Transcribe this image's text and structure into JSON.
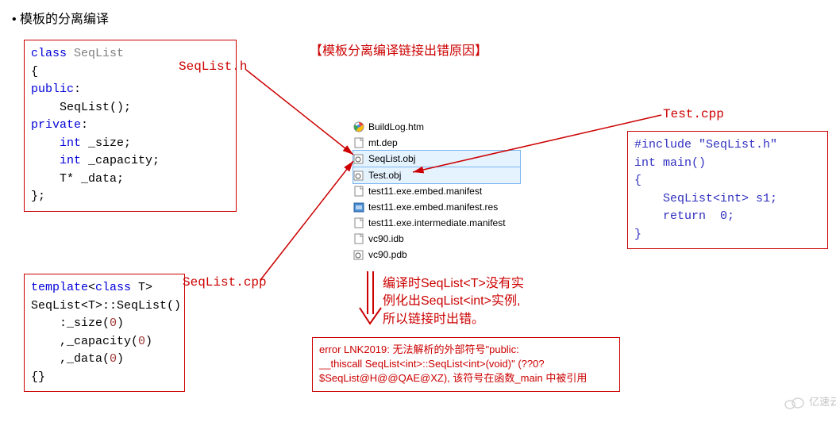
{
  "heading": "模板的分离编译",
  "title_center": "【模板分离编译链接出错原因】",
  "labels": {
    "seqlist_h": "SeqList.h",
    "seqlist_cpp": "SeqList.cpp",
    "test_cpp": "Test.cpp"
  },
  "code_blocks": {
    "seqlist_h": "class SeqList\n{\npublic:\n    SeqList();\nprivate:\n    int _size;\n    int _capacity;\n    T* _data;\n};",
    "seqlist_cpp": "template<class T>\nSeqList<T>::SeqList()\n    :_size(0)\n    ,_capacity(0)\n    ,_data(0)\n{}",
    "test_cpp": "#include \"SeqList.h\"\nint main()\n{\n    SeqList<int> s1;\n    return  0;\n}"
  },
  "file_list": [
    {
      "name": "BuildLog.htm",
      "icon": "chrome"
    },
    {
      "name": "mt.dep",
      "icon": "file"
    },
    {
      "name": "SeqList.obj",
      "icon": "obj",
      "selected": true
    },
    {
      "name": "Test.obj",
      "icon": "obj",
      "selected": true
    },
    {
      "name": "test11.exe.embed.manifest",
      "icon": "file"
    },
    {
      "name": "test11.exe.embed.manifest.res",
      "icon": "res"
    },
    {
      "name": "test11.exe.intermediate.manifest",
      "icon": "file"
    },
    {
      "name": "vc90.idb",
      "icon": "file"
    },
    {
      "name": "vc90.pdb",
      "icon": "obj"
    }
  ],
  "explanation": "编译时SeqList<T>没有实\n例化出SeqList<int>实例,\n所以链接时出错。",
  "error_box": "error LNK2019: 无法解析的外部符号\"public:\n__thiscall SeqList<int>::SeqList<int>(void)\" (??0?\n$SeqList@H@@QAE@XZ), 该符号在函数_main 中被引用",
  "watermark": "亿速云"
}
